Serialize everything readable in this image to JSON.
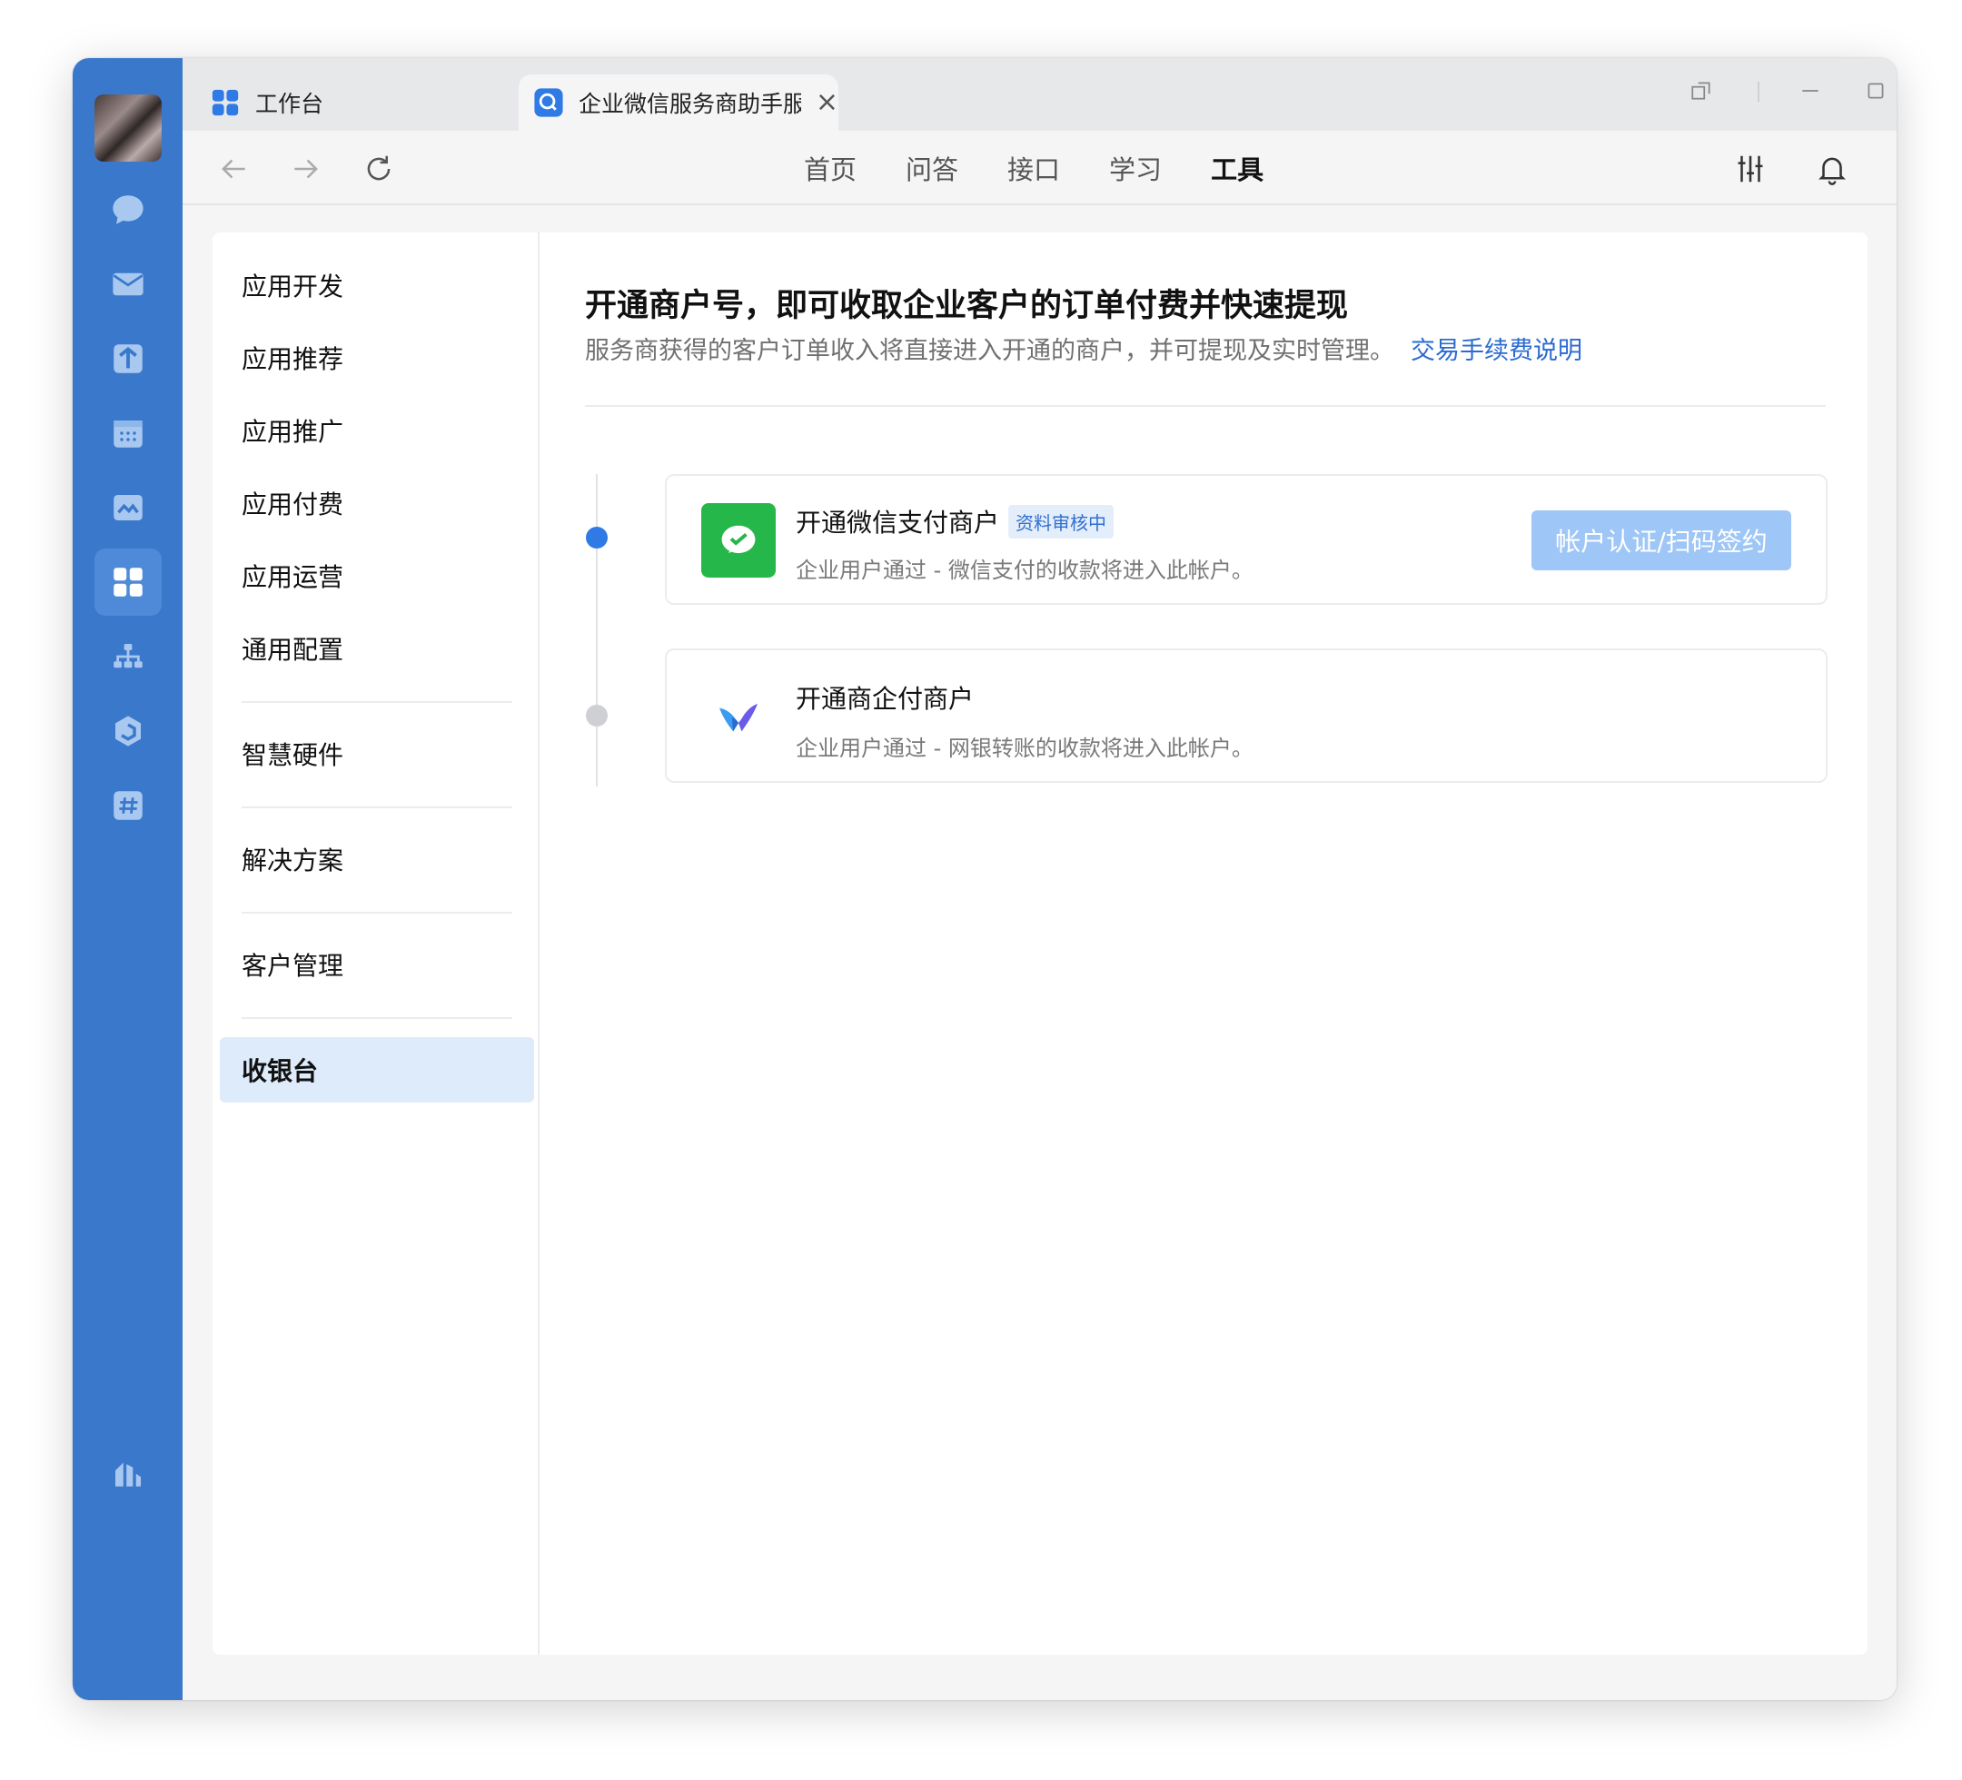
{
  "tabs": [
    {
      "label": "工作台"
    },
    {
      "label": "企业微信服务商助手服务"
    }
  ],
  "topnav": {
    "items": [
      "首页",
      "问答",
      "接口",
      "学习",
      "工具"
    ],
    "active": "工具"
  },
  "sidebar": {
    "items": [
      "应用开发",
      "应用推荐",
      "应用推广",
      "应用付费",
      "应用运营",
      "通用配置",
      "智慧硬件",
      "解决方案",
      "客户管理",
      "收银台"
    ],
    "active": "收银台"
  },
  "main": {
    "title": "开通商户号，即可收取企业客户的订单付费并快速提现",
    "subtitle": "服务商获得的客户订单收入将直接进入开通的商户，并可提现及实时管理。",
    "link": "交易手续费说明"
  },
  "merchants": [
    {
      "title": "开通微信支付商户",
      "badge": "资料审核中",
      "desc": "企业用户通过 - 微信支付的收款将进入此帐户。",
      "button": "帐户认证/扫码签约",
      "icon": "wechat-pay-icon",
      "icon_color": "#26b74a"
    },
    {
      "title": "开通商企付商户",
      "desc": "企业用户通过 - 网银转账的收款将进入此帐户。",
      "icon": "shangqifu-logo-icon"
    }
  ],
  "colors": {
    "rail": "#3a78cc",
    "accent": "#2f7ae5",
    "active_bg": "#deebfb",
    "button_disabled": "#9ec6f6"
  }
}
